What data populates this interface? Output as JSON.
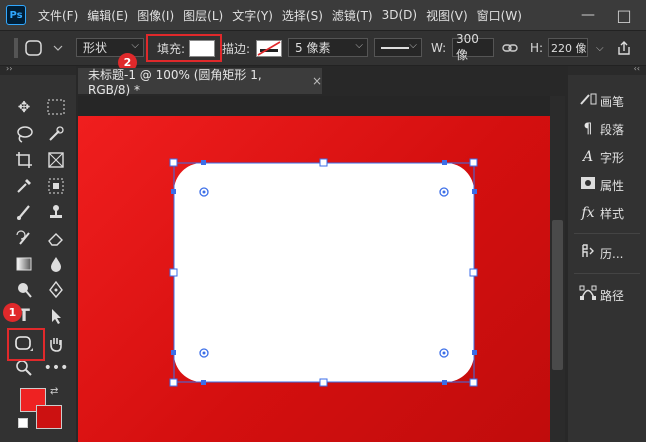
{
  "app": {
    "logo": "Ps"
  },
  "menu": [
    "文件(F)",
    "编辑(E)",
    "图像(I)",
    "图层(L)",
    "文字(Y)",
    "选择(S)",
    "滤镜(T)",
    "3D(D)",
    "视图(V)",
    "窗口(W)"
  ],
  "window_controls": {
    "minimize": "—",
    "maximize": "□"
  },
  "options": {
    "shape_mode": "形状",
    "fill_label": "填充:",
    "stroke_label": "描边:",
    "stroke_width": "5 像素",
    "width_label": "W:",
    "width_value": "300 像",
    "height_label": "H:",
    "height_value": "220 像"
  },
  "collapse_glyph": "‹‹",
  "expand_glyph": "››",
  "annotations": {
    "badge_1": "1",
    "badge_2": "2"
  },
  "document": {
    "tab_title": "未标题-1 @ 100% (圆角矩形 1, RGB/8) *",
    "close": "×"
  },
  "right_panels": [
    "画笔",
    "段落",
    "字形",
    "属性",
    "样式",
    "历...",
    "路径"
  ],
  "colors": {
    "accent_red": "#e0292b",
    "foreground": "#ee2222",
    "background": "#cc1111",
    "selection": "#3b6ee8"
  }
}
